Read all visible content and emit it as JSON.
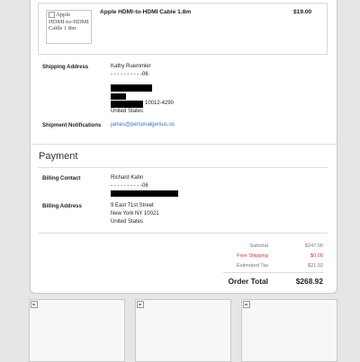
{
  "order_item": {
    "image_alt": "Apple HDMI-to-HDMI Cable 1.8m",
    "name": "Apple HDMI-to-HDMI Cable 1.8m",
    "price": "$19.00"
  },
  "shipping": {
    "address_label": "Shipping Address",
    "name": "Kathy Ruemmler",
    "phone": "- - - - - - - - - -06",
    "zip_line": "10012-4290",
    "country": "United States",
    "notifications_label": "Shipment Notifications",
    "email": "james@personalgenius.us"
  },
  "payment": {
    "title": "Payment",
    "billing_contact_label": "Billing Contact",
    "billing_name": "Richard Kahn",
    "billing_phone": "- - - - - - - - - -06",
    "billing_address_label": "Billing Address",
    "address_line1": "9 East 71st Street",
    "address_line2": "New York NY 10021",
    "address_country": "United States"
  },
  "totals": {
    "subtotal_label": "Subtotal",
    "subtotal_value": "$247.00",
    "shipping_label": "Free Shipping",
    "shipping_value": "$0.00",
    "tax_label": "Estimated Tax",
    "tax_value": "$21.92",
    "order_total_label": "Order Total",
    "order_total_value": "$268.92"
  },
  "colors": {
    "accent_link": "#2a74c7",
    "free_shipping": "#d9352b"
  }
}
